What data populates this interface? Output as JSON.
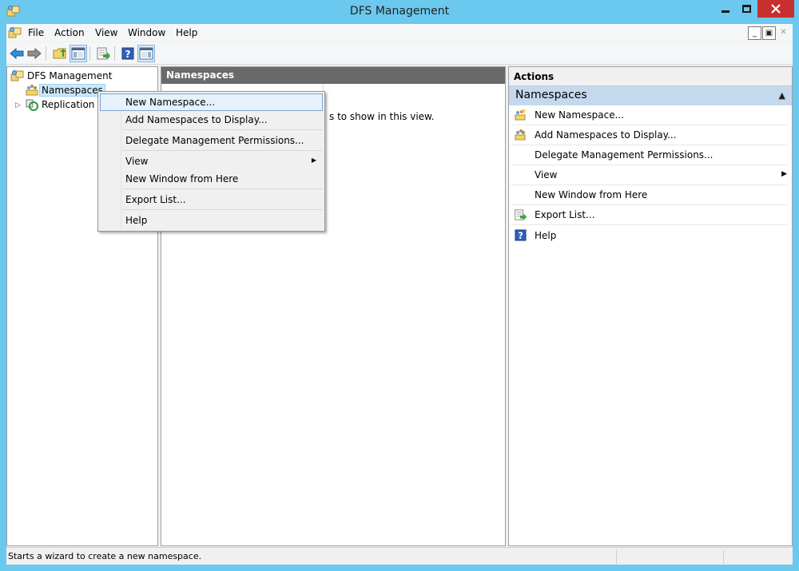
{
  "window": {
    "title": "DFS Management",
    "icon": "dfs-namespace-icon"
  },
  "menubar": {
    "items": [
      "File",
      "Action",
      "View",
      "Window",
      "Help"
    ],
    "mdi_buttons": [
      "_",
      "▣",
      "✕"
    ]
  },
  "toolbar": {
    "buttons": [
      "back-arrow-icon",
      "forward-arrow-icon",
      "up-folder-icon",
      "show-hide-tree-icon",
      "export-list-icon",
      "help-icon",
      "show-hide-action-pane-icon"
    ]
  },
  "tree": {
    "root": "DFS Management",
    "items": [
      "Namespaces",
      "Replication"
    ]
  },
  "center": {
    "header": "Namespaces",
    "empty_partial": "s to show in this view."
  },
  "actions": {
    "header": "Actions",
    "section": "Namespaces",
    "items": [
      {
        "label": "New Namespace...",
        "icon": "new-namespace-icon"
      },
      {
        "label": "Add Namespaces to Display...",
        "icon": "add-namespace-icon"
      },
      {
        "label": "Delegate Management Permissions...",
        "icon": ""
      },
      {
        "label": "View",
        "icon": "",
        "submenu": true
      },
      {
        "label": "New Window from Here",
        "icon": ""
      },
      {
        "label": "Export List...",
        "icon": "export-list-icon"
      },
      {
        "label": "Help",
        "icon": "help-icon"
      }
    ]
  },
  "context_menu": {
    "items": [
      "New Namespace...",
      "Add Namespaces to Display...",
      "Delegate Management Permissions...",
      "View",
      "New Window from Here",
      "Export List...",
      "Help"
    ]
  },
  "status": {
    "text": "Starts a wizard to create a new namespace."
  },
  "colors": {
    "titlebar": "#6bc8ee",
    "close_button": "#c7302e",
    "pane_header": "#6a6a6a",
    "actions_section": "#c5d9ee",
    "menu_highlight": "#e5f1fb"
  }
}
